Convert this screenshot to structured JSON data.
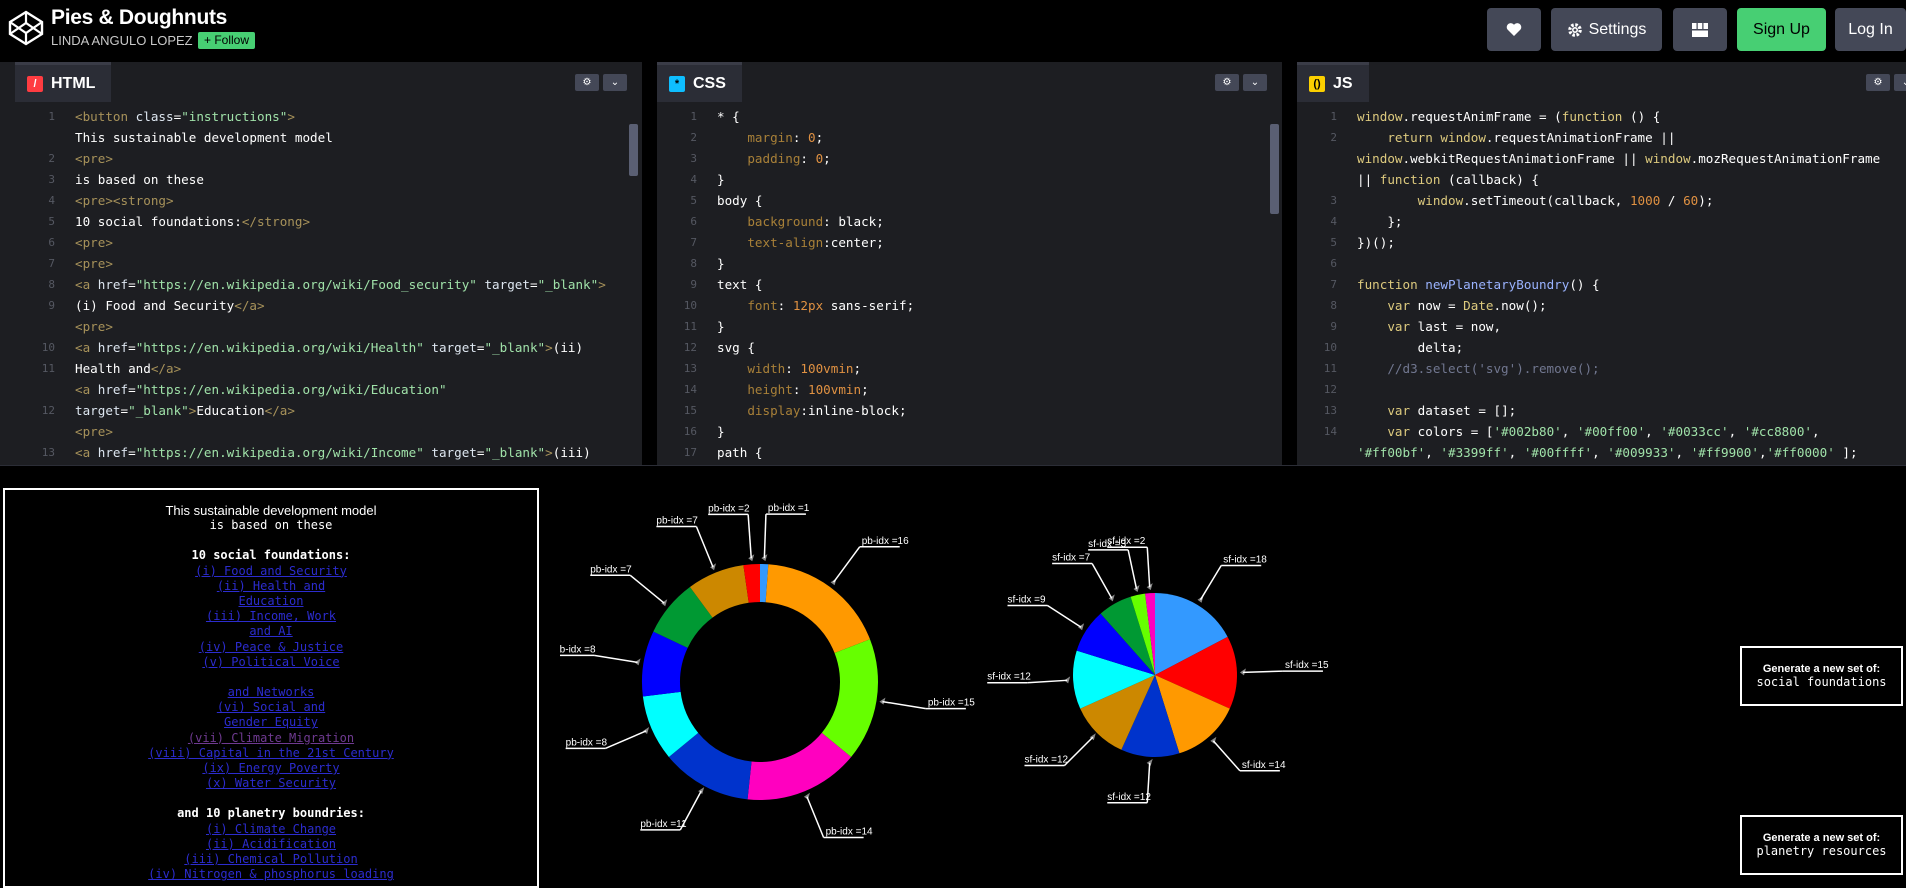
{
  "header": {
    "title": "Pies & Doughnuts",
    "author": "LINDA ANGULO LOPEZ",
    "follow_label": "+ Follow",
    "settings_label": "Settings",
    "signup_label": "Sign Up",
    "login_label": "Log In",
    "icons": [
      "codepen-logo-icon",
      "heart-icon",
      "gear-icon",
      "grid-layout-icon"
    ]
  },
  "editors": {
    "html": {
      "label": "HTML",
      "lines": [
        {
          "n": "1",
          "parts": [
            [
              "c-tag",
              "<button "
            ],
            [
              "c-attr",
              "class"
            ],
            [
              "",
              "="
            ],
            [
              "c-str",
              "\"instructions\""
            ],
            [
              "c-tag",
              ">"
            ]
          ]
        },
        {
          "n": "",
          "parts": [
            [
              "",
              "This sustainable development model"
            ]
          ]
        },
        {
          "n": "2",
          "parts": [
            [
              "c-tag",
              "<pre>"
            ]
          ]
        },
        {
          "n": "3",
          "parts": [
            [
              "",
              "is based on these"
            ]
          ]
        },
        {
          "n": "4",
          "parts": [
            [
              "c-tag",
              "<pre><strong>"
            ]
          ]
        },
        {
          "n": "5",
          "parts": [
            [
              "",
              "10 social foundations:"
            ],
            [
              "c-tag",
              "</strong>"
            ]
          ]
        },
        {
          "n": "6",
          "parts": [
            [
              "c-tag",
              "<pre>"
            ]
          ]
        },
        {
          "n": "7",
          "parts": [
            [
              "c-tag",
              "<pre>"
            ]
          ]
        },
        {
          "n": "8",
          "parts": [
            [
              "c-tag",
              "<a "
            ],
            [
              "c-attr",
              "href"
            ],
            [
              "",
              "="
            ],
            [
              "c-str",
              "\"https://en.wikipedia.org/wiki/Food_security\""
            ],
            [
              "c-attr",
              " target"
            ],
            [
              "",
              "="
            ],
            [
              "c-str",
              "\"_blank\""
            ],
            [
              "c-tag",
              ">"
            ]
          ]
        },
        {
          "n": "9",
          "parts": [
            [
              "",
              "(i) Food and Security"
            ],
            [
              "c-tag",
              "</a>"
            ]
          ]
        },
        {
          "n": "",
          "parts": [
            [
              "c-tag",
              "<pre>"
            ]
          ]
        },
        {
          "n": "10",
          "parts": [
            [
              "c-tag",
              "<a "
            ],
            [
              "c-attr",
              "href"
            ],
            [
              "",
              "="
            ],
            [
              "c-str",
              "\"https://en.wikipedia.org/wiki/Health\""
            ],
            [
              "c-attr",
              " target"
            ],
            [
              "",
              "="
            ],
            [
              "c-str",
              "\"_blank\""
            ],
            [
              "c-tag",
              ">"
            ],
            [
              "",
              "(ii)"
            ]
          ]
        },
        {
          "n": "11",
          "parts": [
            [
              "",
              "Health and"
            ],
            [
              "c-tag",
              "</a>"
            ]
          ]
        },
        {
          "n": "",
          "parts": [
            [
              "c-tag",
              "<a "
            ],
            [
              "c-attr",
              "href"
            ],
            [
              "",
              "="
            ],
            [
              "c-str",
              "\"https://en.wikipedia.org/wiki/Education\""
            ]
          ]
        },
        {
          "n": "12",
          "parts": [
            [
              "c-attr",
              "target"
            ],
            [
              "",
              "="
            ],
            [
              "c-str",
              "\"_blank\""
            ],
            [
              "c-tag",
              ">"
            ],
            [
              "",
              "Education"
            ],
            [
              "c-tag",
              "</a>"
            ]
          ]
        },
        {
          "n": "",
          "parts": [
            [
              "c-tag",
              "<pre>"
            ]
          ]
        },
        {
          "n": "13",
          "parts": [
            [
              "c-tag",
              "<a "
            ],
            [
              "c-attr",
              "href"
            ],
            [
              "",
              "="
            ],
            [
              "c-str",
              "\"https://en.wikipedia.org/wiki/Income\""
            ],
            [
              "c-attr",
              " target"
            ],
            [
              "",
              "="
            ],
            [
              "c-str",
              "\"_blank\""
            ],
            [
              "c-tag",
              ">"
            ],
            [
              "",
              "(iii)"
            ]
          ]
        }
      ]
    },
    "css": {
      "label": "CSS",
      "lines": [
        {
          "n": "1",
          "parts": [
            [
              "",
              "* {"
            ]
          ]
        },
        {
          "n": "2",
          "parts": [
            [
              "c-prop",
              "    margin"
            ],
            [
              "",
              ": "
            ],
            [
              "c-num",
              "0"
            ],
            [
              "",
              ";"
            ]
          ]
        },
        {
          "n": "3",
          "parts": [
            [
              "c-prop",
              "    padding"
            ],
            [
              "",
              ": "
            ],
            [
              "c-num",
              "0"
            ],
            [
              "",
              ";"
            ]
          ]
        },
        {
          "n": "4",
          "parts": [
            [
              "",
              "}"
            ]
          ]
        },
        {
          "n": "5",
          "parts": [
            [
              "",
              "body {"
            ]
          ]
        },
        {
          "n": "6",
          "parts": [
            [
              "c-prop",
              "    background"
            ],
            [
              "",
              ": black;"
            ]
          ]
        },
        {
          "n": "7",
          "parts": [
            [
              "c-prop",
              "    text-align"
            ],
            [
              "",
              ":center;"
            ]
          ]
        },
        {
          "n": "8",
          "parts": [
            [
              "",
              "}"
            ]
          ]
        },
        {
          "n": "9",
          "parts": [
            [
              "",
              "text {"
            ]
          ]
        },
        {
          "n": "10",
          "parts": [
            [
              "c-prop",
              "    font"
            ],
            [
              "",
              ": "
            ],
            [
              "c-num",
              "12px"
            ],
            [
              "",
              " sans-serif;"
            ]
          ]
        },
        {
          "n": "11",
          "parts": [
            [
              "",
              "}"
            ]
          ]
        },
        {
          "n": "12",
          "parts": [
            [
              "",
              "svg {"
            ]
          ]
        },
        {
          "n": "13",
          "parts": [
            [
              "c-prop",
              "    width"
            ],
            [
              "",
              ": "
            ],
            [
              "c-num",
              "100vmin"
            ],
            [
              "",
              ";"
            ]
          ]
        },
        {
          "n": "14",
          "parts": [
            [
              "c-prop",
              "    height"
            ],
            [
              "",
              ": "
            ],
            [
              "c-num",
              "100vmin"
            ],
            [
              "",
              ";"
            ]
          ]
        },
        {
          "n": "15",
          "parts": [
            [
              "c-prop",
              "    display"
            ],
            [
              "",
              ":inline-block;"
            ]
          ]
        },
        {
          "n": "16",
          "parts": [
            [
              "",
              "}"
            ]
          ]
        },
        {
          "n": "17",
          "parts": [
            [
              "",
              "path {"
            ]
          ]
        }
      ]
    },
    "js": {
      "label": "JS",
      "lines": [
        {
          "n": "1",
          "parts": [
            [
              "c-js-kw",
              "window"
            ],
            [
              "",
              ".requestAnimFrame = ("
            ],
            [
              "c-js-kw",
              "function"
            ],
            [
              "",
              " () {"
            ]
          ]
        },
        {
          "n": "2",
          "parts": [
            [
              "c-js-kw",
              "    return "
            ],
            [
              "c-js-kw",
              "window"
            ],
            [
              "",
              ".requestAnimationFrame ||"
            ]
          ]
        },
        {
          "n": "",
          "parts": [
            [
              "c-js-kw",
              "window"
            ],
            [
              "",
              ".webkitRequestAnimationFrame || "
            ],
            [
              "c-js-kw",
              "window"
            ],
            [
              "",
              ".mozRequestAnimationFrame"
            ]
          ]
        },
        {
          "n": "",
          "parts": [
            [
              "",
              "|| "
            ],
            [
              "c-js-kw",
              "function"
            ],
            [
              "",
              " (callback) {"
            ]
          ]
        },
        {
          "n": "3",
          "parts": [
            [
              "c-js-kw",
              "        window"
            ],
            [
              "",
              ".setTimeout(callback, "
            ],
            [
              "c-num",
              "1000"
            ],
            [
              "",
              " / "
            ],
            [
              "c-num",
              "60"
            ],
            [
              "",
              ");"
            ]
          ]
        },
        {
          "n": "4",
          "parts": [
            [
              "",
              "    };"
            ]
          ]
        },
        {
          "n": "5",
          "parts": [
            [
              "",
              "})();"
            ]
          ]
        },
        {
          "n": "6",
          "parts": [
            [
              "",
              ""
            ]
          ]
        },
        {
          "n": "7",
          "parts": [
            [
              "c-js-kw",
              "function "
            ],
            [
              "c-js-fn",
              "newPlanetaryBoundry"
            ],
            [
              "",
              "() {"
            ]
          ]
        },
        {
          "n": "8",
          "parts": [
            [
              "c-js-kw",
              "    var "
            ],
            [
              "",
              "now = "
            ],
            [
              "c-js-kw",
              "Date"
            ],
            [
              "",
              ".now();"
            ]
          ]
        },
        {
          "n": "9",
          "parts": [
            [
              "c-js-kw",
              "    var "
            ],
            [
              "",
              "last = now,"
            ]
          ]
        },
        {
          "n": "10",
          "parts": [
            [
              "",
              "        delta;"
            ]
          ]
        },
        {
          "n": "11",
          "parts": [
            [
              "c-cm",
              "    //d3.select('svg').remove();"
            ]
          ]
        },
        {
          "n": "12",
          "parts": [
            [
              "",
              ""
            ]
          ]
        },
        {
          "n": "13",
          "parts": [
            [
              "c-js-kw",
              "    var "
            ],
            [
              "",
              "dataset = [];"
            ]
          ]
        },
        {
          "n": "14",
          "parts": [
            [
              "c-js-kw",
              "    var "
            ],
            [
              "",
              "colors = ["
            ],
            [
              "c-js-str",
              "'#002b80'"
            ],
            [
              "",
              ", "
            ],
            [
              "c-js-str",
              "'#00ff00'"
            ],
            [
              "",
              ", "
            ],
            [
              "c-js-str",
              "'#0033cc'"
            ],
            [
              "",
              ", "
            ],
            [
              "c-js-str",
              "'#cc8800'"
            ],
            [
              "",
              ","
            ]
          ]
        },
        {
          "n": "",
          "parts": [
            [
              "c-js-str",
              "'#ff00bf'"
            ],
            [
              "",
              ", "
            ],
            [
              "c-js-str",
              "'#3399ff'"
            ],
            [
              "",
              ", "
            ],
            [
              "c-js-str",
              "'#00ffff'"
            ],
            [
              "",
              ", "
            ],
            [
              "c-js-str",
              "'#009933'"
            ],
            [
              "",
              ", "
            ],
            [
              "c-js-str",
              "'#ff9900'"
            ],
            [
              "",
              ","
            ],
            [
              "c-js-str",
              "'#ff0000'"
            ],
            [
              "",
              " ];"
            ]
          ]
        }
      ]
    }
  },
  "preview": {
    "intro_1": "This sustainable development model",
    "intro_2": "is based on these",
    "social_heading": "10 social foundations:",
    "social_links": [
      "(i) Food and Security",
      "(ii) Health and",
      "Education",
      "(iii) Income, Work",
      "and AI",
      "(iv) Peace & Justice",
      "(v) Political Voice",
      "",
      "and Networks",
      "(vi) Social and",
      "Gender Equity",
      "(vii) Climate Migration",
      "(viii) Capital in the 21st Century",
      "(ix) Energy Poverty",
      "(x) Water Security"
    ],
    "planetary_heading": "and 10 planetry boundries:",
    "planetary_links": [
      "(i) Climate Change",
      "(ii) Acidification",
      "(iii) Chemical Pollution",
      "(iv) Nitrogen & phosphorus loading"
    ],
    "gen_social_line1": "Generate a new set of:",
    "gen_social_line2": "social foundations",
    "gen_planetary_line1": "Generate a new set of:",
    "gen_planetary_line2": "planetry resources"
  },
  "chart_data": [
    {
      "type": "pie",
      "variant": "doughnut",
      "slices": [
        {
          "label": "pb-idx =1",
          "value": 1,
          "color": "#3399ff"
        },
        {
          "label": "pb-idx =16",
          "value": 16,
          "color": "#ff9900"
        },
        {
          "label": "pb-idx =15",
          "value": 15,
          "color": "#66ff00"
        },
        {
          "label": "pb-idx =14",
          "value": 14,
          "color": "#ff00bf"
        },
        {
          "label": "pb-idx =11",
          "value": 11,
          "color": "#0033cc"
        },
        {
          "label": "pb-idx =8",
          "value": 8,
          "color": "#00ffff"
        },
        {
          "label": "pb-idx =8",
          "value": 8,
          "color": "#0000ff"
        },
        {
          "label": "pb-idx =7",
          "value": 7,
          "color": "#009933"
        },
        {
          "label": "pb-idx =7",
          "value": 7,
          "color": "#cc8800"
        },
        {
          "label": "pb-idx =2",
          "value": 2,
          "color": "#ff0000"
        }
      ]
    },
    {
      "type": "pie",
      "slices": [
        {
          "label": "sf-idx =18",
          "value": 18,
          "color": "#3399ff"
        },
        {
          "label": "sf-idx =15",
          "value": 15,
          "color": "#ff0000"
        },
        {
          "label": "sf-idx =14",
          "value": 14,
          "color": "#ff9900"
        },
        {
          "label": "sf-idx =12",
          "value": 12,
          "color": "#0033cc"
        },
        {
          "label": "sf-idx =12",
          "value": 12,
          "color": "#cc8800"
        },
        {
          "label": "sf-idx =12",
          "value": 12,
          "color": "#00ffff"
        },
        {
          "label": "sf-idx =9",
          "value": 9,
          "color": "#0000ff"
        },
        {
          "label": "sf-idx =7",
          "value": 7,
          "color": "#009933"
        },
        {
          "label": "sf-idx =3",
          "value": 3,
          "color": "#66ff00"
        },
        {
          "label": "sf-idx =2",
          "value": 2,
          "color": "#ff00bf"
        }
      ]
    }
  ]
}
